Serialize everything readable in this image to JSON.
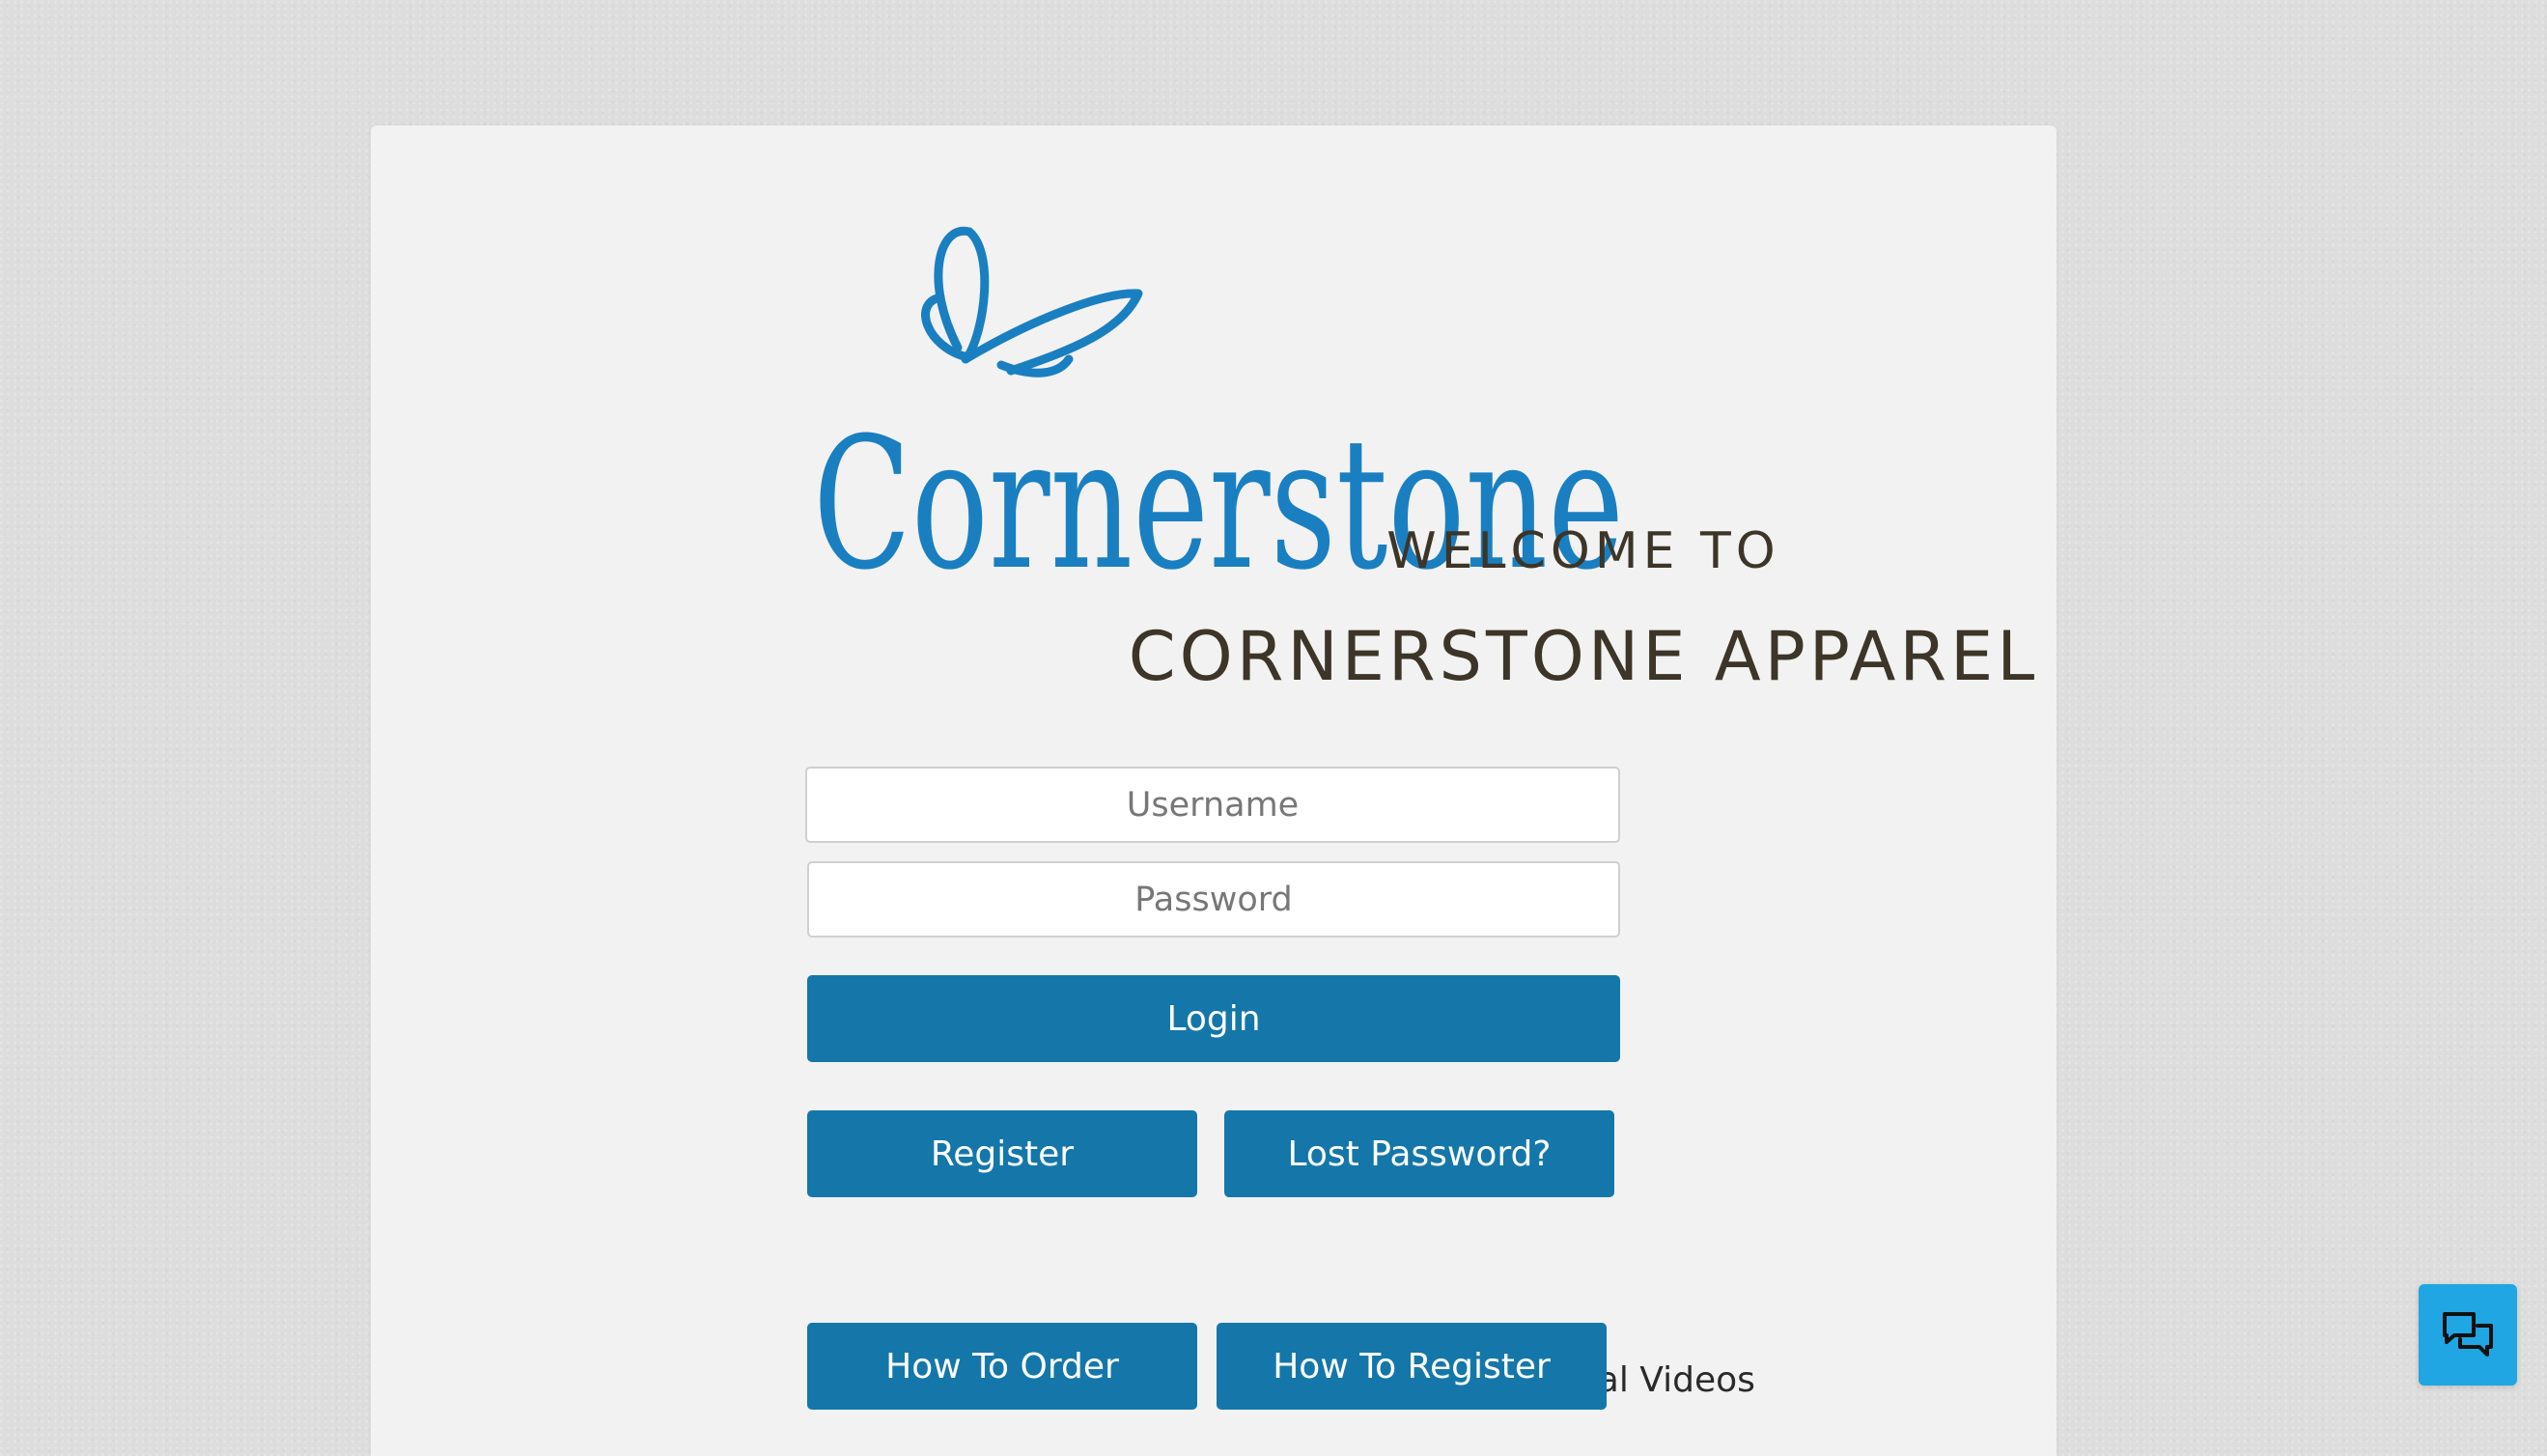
{
  "brand": {
    "logo_text": "Cornerstone",
    "brand_color": "#1a7fc1"
  },
  "heading": {
    "welcome": "WELCOME TO",
    "store_name": "CORNERSTONE APPAREL"
  },
  "form": {
    "username_placeholder": "Username",
    "username_value": "",
    "password_placeholder": "Password",
    "password_value": "",
    "login_label": "Login"
  },
  "secondary_actions": {
    "register_label": "Register",
    "lost_password_label": "Lost Password?"
  },
  "videos": {
    "heading": "Instructional Videos",
    "how_to_order_label": "How To Order",
    "how_to_register_label": "How To Register"
  },
  "chat": {
    "icon": "chat-bubbles-icon",
    "color": "#1fa6e3"
  },
  "colors": {
    "button": "#1577a9",
    "page_background": "#dddddd",
    "card_background": "#f2f2f2",
    "heading_text": "#3c3528"
  }
}
